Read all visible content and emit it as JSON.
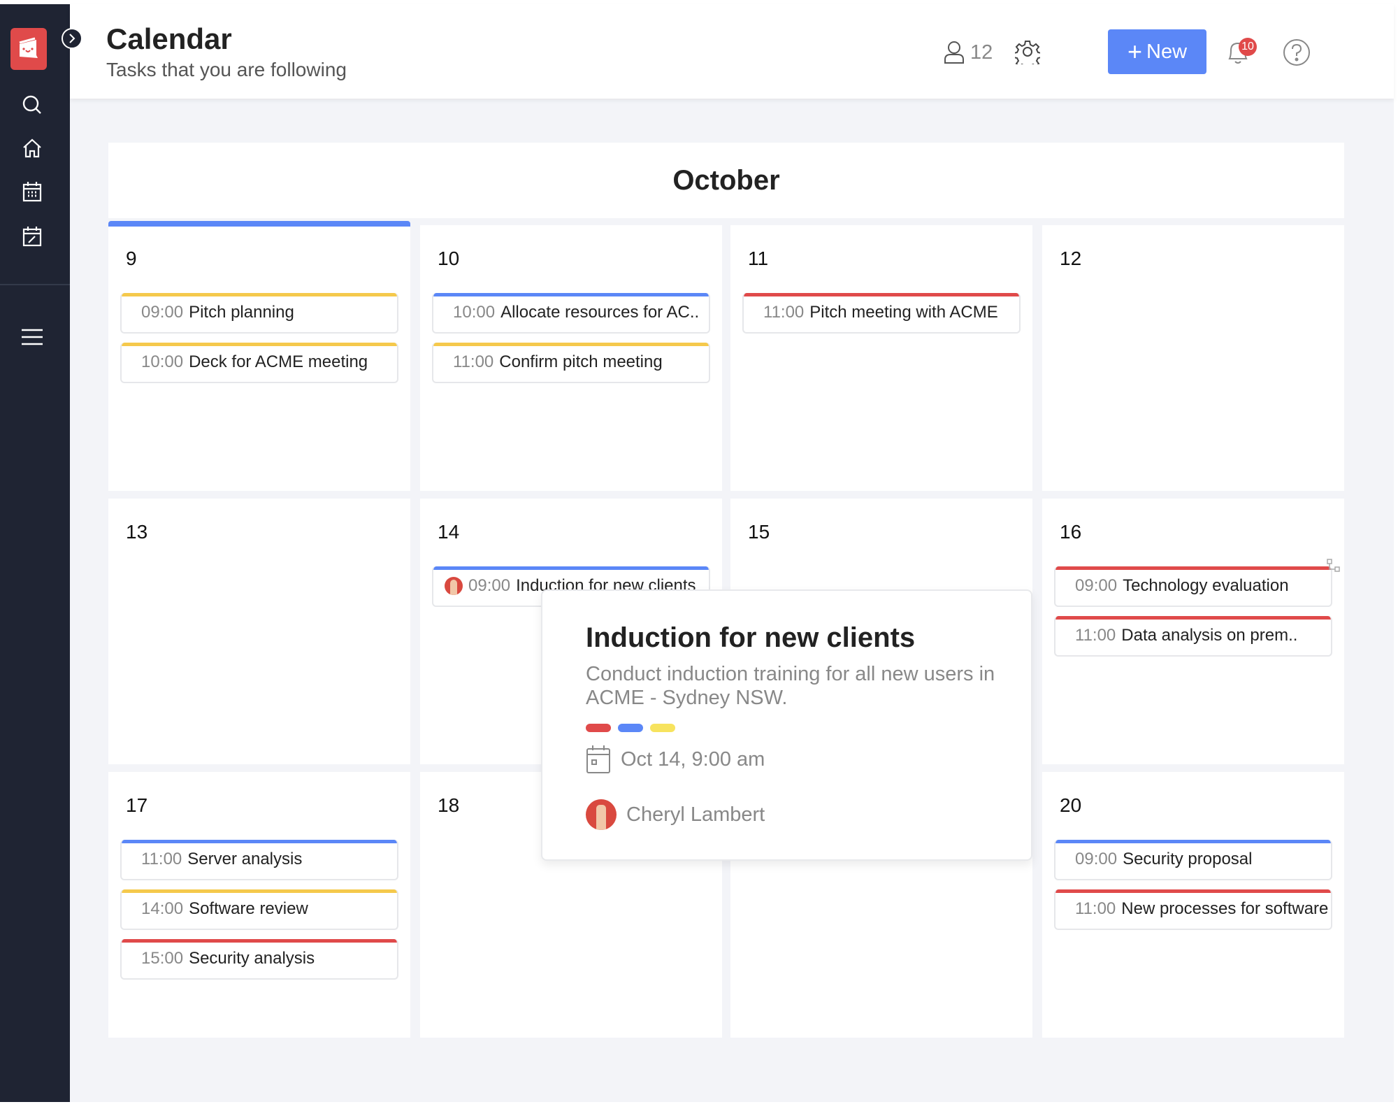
{
  "header": {
    "title": "Calendar",
    "subtitle": "Tasks that you are following",
    "followers_count": "12",
    "new_label": "New",
    "notification_count": "10"
  },
  "sidebar": {
    "items": [
      {
        "icon": "search-icon"
      },
      {
        "icon": "home-icon"
      },
      {
        "icon": "calendar-icon"
      },
      {
        "icon": "calendar-edit-icon"
      },
      {
        "icon": "menu-icon"
      }
    ]
  },
  "calendar": {
    "month": "October",
    "days": [
      {
        "day": "9",
        "today": true,
        "events": [
          {
            "time": "09:00",
            "title": "Pitch planning",
            "color": "#f5c94c"
          },
          {
            "time": "10:00",
            "title": "Deck for ACME meeting",
            "color": "#f5c94c"
          }
        ]
      },
      {
        "day": "10",
        "events": [
          {
            "time": "10:00",
            "title": "Allocate resources for AC..",
            "color": "#5b87f7"
          },
          {
            "time": "11:00",
            "title": "Confirm pitch meeting",
            "color": "#f5c94c"
          }
        ]
      },
      {
        "day": "11",
        "events": [
          {
            "time": "11:00",
            "title": "Pitch meeting with ACME",
            "color": "#e04a4a"
          }
        ]
      },
      {
        "day": "12",
        "events": []
      },
      {
        "day": "13",
        "events": []
      },
      {
        "day": "14",
        "events": [
          {
            "time": "09:00",
            "title": "Induction for new clients",
            "color": "#5b87f7",
            "avatar": true
          }
        ]
      },
      {
        "day": "15",
        "events": []
      },
      {
        "day": "16",
        "events": [
          {
            "time": "09:00",
            "title": "Technology evaluation",
            "color": "#e04a4a"
          },
          {
            "time": "11:00",
            "title": "Data analysis on prem..",
            "color": "#e04a4a"
          }
        ]
      },
      {
        "day": "17",
        "events": [
          {
            "time": "11:00",
            "title": "Server analysis",
            "color": "#5b87f7"
          },
          {
            "time": "14:00",
            "title": "Software review",
            "color": "#f5c94c"
          },
          {
            "time": "15:00",
            "title": "Security analysis",
            "color": "#e04a4a"
          }
        ]
      },
      {
        "day": "18",
        "events": []
      },
      {
        "day": "",
        "events": []
      },
      {
        "day": "20",
        "events": [
          {
            "time": "09:00",
            "title": "Security proposal",
            "color": "#5b87f7"
          },
          {
            "time": "11:00",
            "title": "New processes for software",
            "color": "#e04a4a"
          }
        ]
      }
    ]
  },
  "popup": {
    "title": "Induction for new clients",
    "description": "Conduct induction training for all new users in ACME - Sydney NSW.",
    "tags": [
      "#e04a4a",
      "#5b87f7",
      "#f7e35e"
    ],
    "date": "Oct 14, 9:00 am",
    "assignee": "Cheryl Lambert"
  }
}
